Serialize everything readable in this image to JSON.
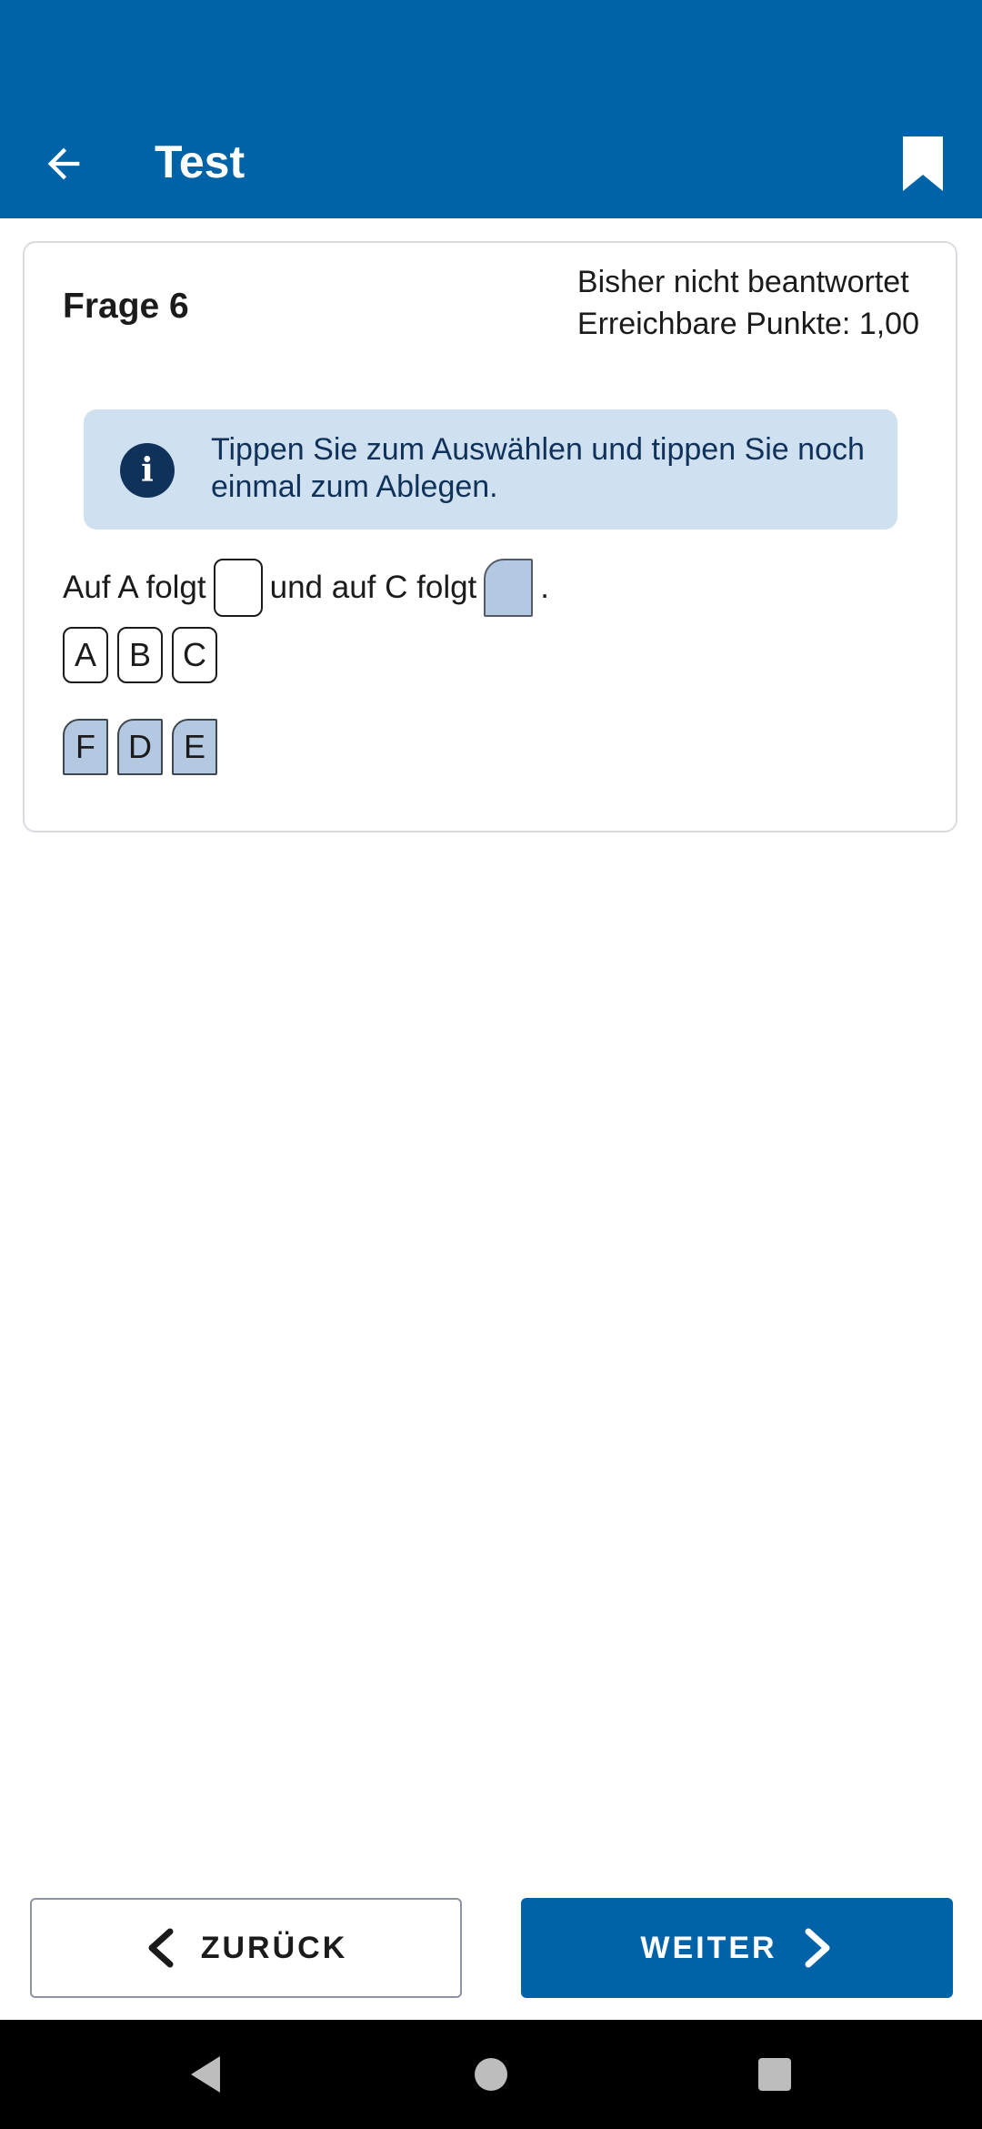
{
  "header": {
    "title": "Test",
    "back_icon": "arrow-left-icon",
    "bookmark_icon": "bookmark-icon",
    "color": "#0063a7"
  },
  "question": {
    "title": "Frage 6",
    "status": "Bisher nicht beantwortet",
    "points": "Erreichbare Punkte: 1,00",
    "info": {
      "icon": "info-icon",
      "text": "Tippen Sie zum Auswählen und tippen Sie noch einmal zum Ablegen."
    },
    "sentence": {
      "part1": "Auf A folgt",
      "part2": "und auf C folgt",
      "part3": "."
    },
    "group1": [
      "A",
      "B",
      "C"
    ],
    "group2": [
      "F",
      "D",
      "E"
    ]
  },
  "buttons": {
    "back_label": "ZURÜCK",
    "next_label": "WEITER"
  },
  "navbar": {
    "icons": [
      "nav-back-icon",
      "nav-home-icon",
      "nav-recents-icon"
    ]
  }
}
